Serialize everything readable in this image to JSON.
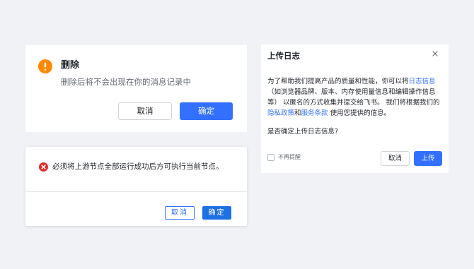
{
  "colors": {
    "background": "#f1f2f5",
    "primary": "#3370ff",
    "warning": "#ff8800",
    "error": "#e02d2d",
    "link": "#3370ff"
  },
  "delete_dialog": {
    "icon": "warning-icon",
    "title": "删除",
    "message": "删除后将不会出现在你的消息记录中",
    "cancel_label": "取消",
    "confirm_label": "确定"
  },
  "error_dialog": {
    "icon": "error-icon",
    "message": "必须将上游节点全部运行成功后方可执行当前节点。",
    "cancel_label": "取消",
    "confirm_label": "确定"
  },
  "upload_dialog": {
    "title": "上传日志",
    "close_icon": "close-icon",
    "body_prefix": "为了帮助我们提高产品的质量和性能，你可以将",
    "log_link": "日志信息",
    "body_middle": "（如浏览器品牌、版本、内存使用量信息和编辑操作信息等） 以匿名的方式收集并提交给飞书。 我们将根据我们的",
    "privacy_link": "隐私政策",
    "and_text": "和",
    "terms_link": "服务条款",
    "body_suffix": " 使用您提供的信息。",
    "question": "是否确定上传日志信息?",
    "checkbox_label": "不再提醒",
    "cancel_label": "取消",
    "upload_label": "上传"
  }
}
